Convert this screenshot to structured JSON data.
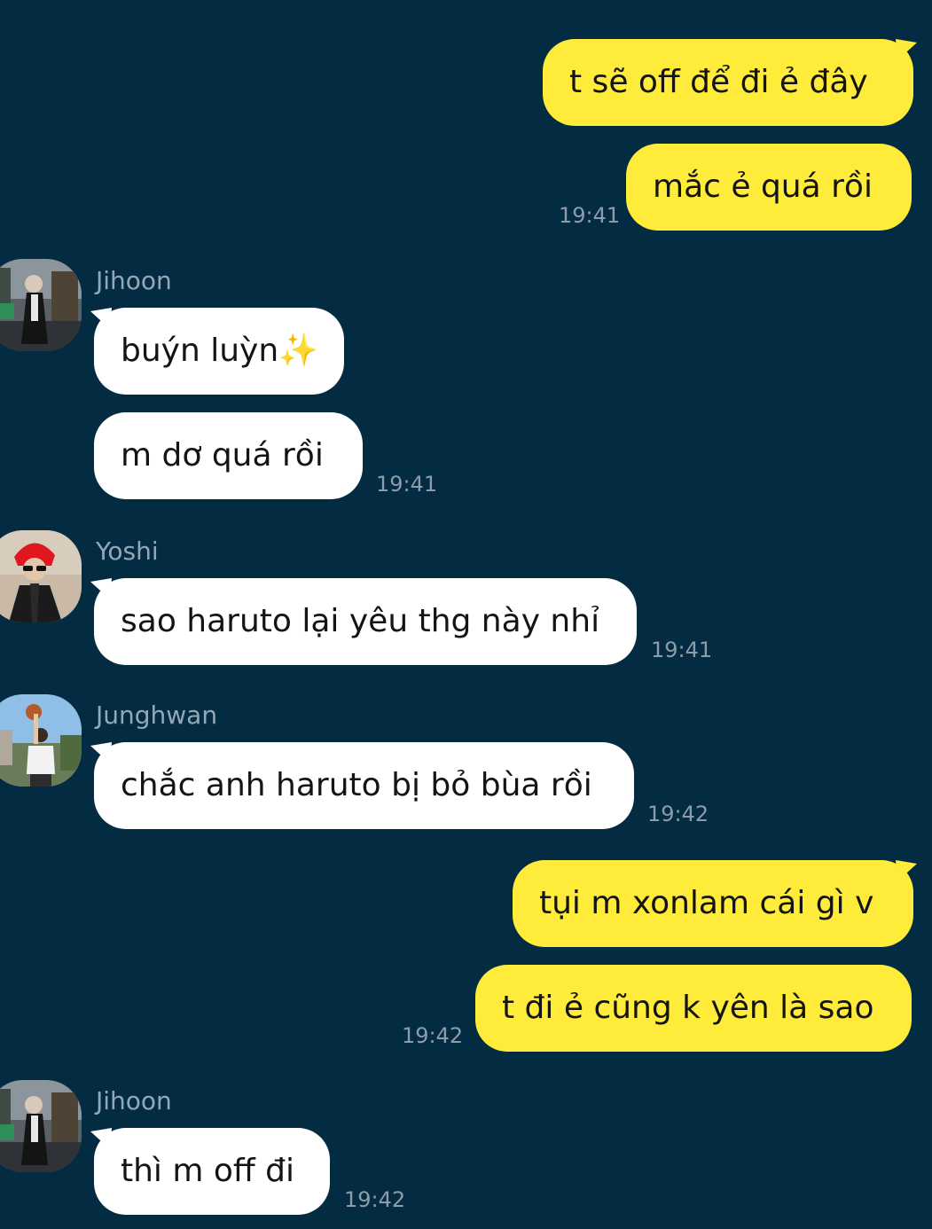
{
  "messages": [
    {
      "id": 1,
      "text": "t sẽ off để đi ẻ đây"
    },
    {
      "id": 2,
      "text": "mắc ẻ quá rồi",
      "time": "19:41"
    },
    {
      "id": 3,
      "sender": "Jihoon",
      "text": "buýn luỳn",
      "emoji": "✨"
    },
    {
      "id": 4,
      "text": "m dơ quá rồi",
      "time": "19:41"
    },
    {
      "id": 5,
      "sender": "Yoshi",
      "text": "sao haruto lại yêu thg này nhỉ",
      "time": "19:41"
    },
    {
      "id": 6,
      "sender": "Junghwan",
      "text": "chắc anh haruto bị bỏ bùa rồi",
      "time": "19:42"
    },
    {
      "id": 7,
      "text": "tụi m xonlam cái gì v"
    },
    {
      "id": 8,
      "text": "t đi ẻ cũng k yên là sao",
      "time": "19:42"
    },
    {
      "id": 9,
      "sender": "Jihoon",
      "text": "thì m off đi",
      "time": "19:42"
    }
  ],
  "colors": {
    "background": "#032C43",
    "my_bubble": "#FEEB3A",
    "their_bubble": "#FFFFFF",
    "sender_name": "#93A8B7",
    "timestamp": "#8C9CA8"
  }
}
